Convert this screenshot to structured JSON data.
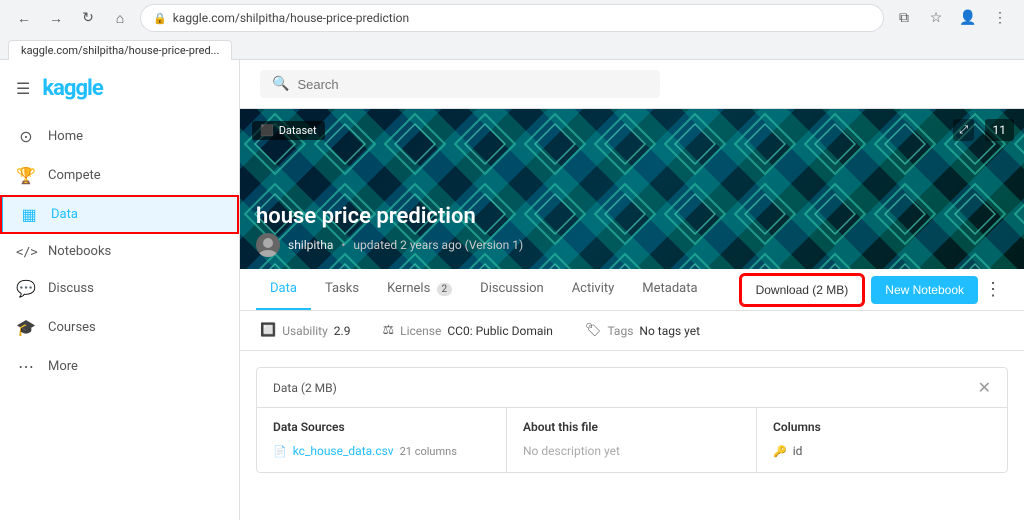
{
  "browser": {
    "url": "kaggle.com/shilpitha/house-price-prediction",
    "tab_label": "kaggle.com/shilpitha/house-price-pred..."
  },
  "header": {
    "search_placeholder": "Search"
  },
  "sidebar": {
    "logo": "kaggle",
    "items": [
      {
        "id": "home",
        "label": "Home",
        "icon": "⊙"
      },
      {
        "id": "compete",
        "label": "Compete",
        "icon": "🏆"
      },
      {
        "id": "data",
        "label": "Data",
        "icon": "▦",
        "active": true
      },
      {
        "id": "notebooks",
        "label": "Notebooks",
        "icon": "</>"
      },
      {
        "id": "discuss",
        "label": "Discuss",
        "icon": "💬"
      },
      {
        "id": "courses",
        "label": "Courses",
        "icon": "🎓"
      },
      {
        "id": "more",
        "label": "More",
        "icon": "⋯"
      }
    ]
  },
  "dataset": {
    "badge": "Dataset",
    "count": "11",
    "title": "house price prediction",
    "author": "shilpitha",
    "updated": "updated 2 years ago (Version 1)",
    "usability_label": "Usability",
    "usability_value": "2.9",
    "license_label": "License",
    "license_value": "CC0: Public Domain",
    "tags_label": "Tags",
    "tags_value": "No tags yet"
  },
  "tabs": {
    "items": [
      {
        "id": "data",
        "label": "Data",
        "active": true
      },
      {
        "id": "tasks",
        "label": "Tasks"
      },
      {
        "id": "kernels",
        "label": "Kernels",
        "badge": "2"
      },
      {
        "id": "discussion",
        "label": "Discussion"
      },
      {
        "id": "activity",
        "label": "Activity"
      },
      {
        "id": "metadata",
        "label": "Metadata"
      }
    ],
    "download_btn": "Download (2 MB)",
    "new_notebook_btn": "New Notebook"
  },
  "data_card": {
    "title": "Data (2 MB)",
    "columns": [
      {
        "title": "Data Sources",
        "items": [
          {
            "name": "kc_house_data.csv",
            "detail": "21 columns"
          }
        ]
      },
      {
        "title": "About this file",
        "items": [
          {
            "name": "No description yet"
          }
        ]
      },
      {
        "title": "Columns",
        "items": [
          {
            "name": "id"
          }
        ]
      }
    ]
  }
}
